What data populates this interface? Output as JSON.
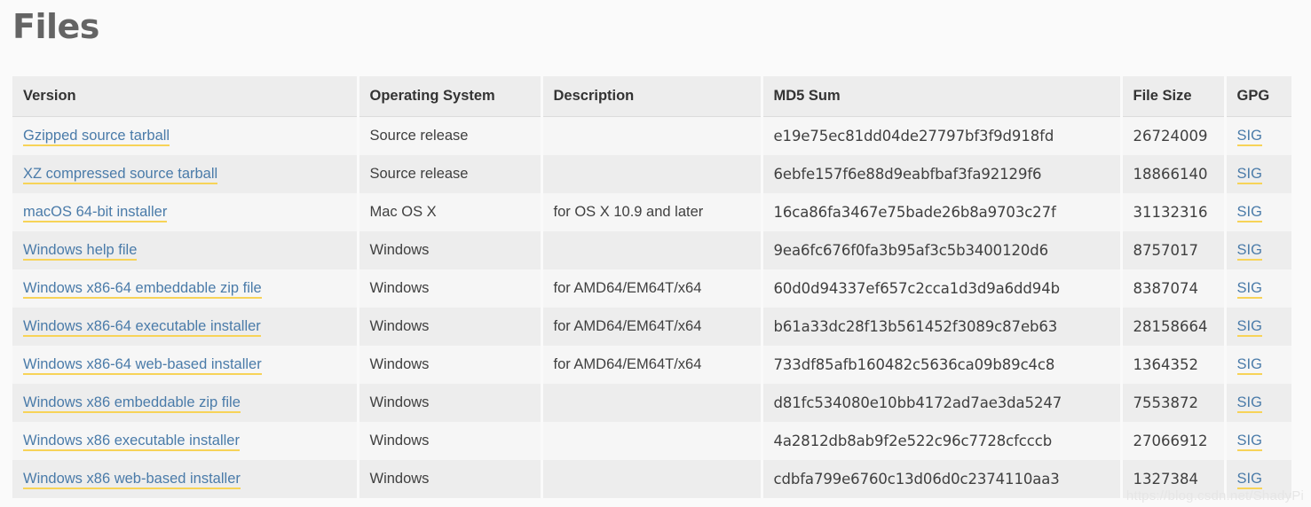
{
  "page": {
    "title": "Files",
    "watermark": "https://blog.csdn.net/ShadyPi",
    "accent_link_color": "#4a7ba9",
    "accent_underline_color": "#f7d358",
    "header_bg": "#ededed",
    "row_odd_bg": "#f6f6f6",
    "row_even_bg": "#ededed",
    "page_bg": "#fafafa",
    "title_color": "#646464"
  },
  "table": {
    "columns": [
      {
        "key": "version",
        "label": "Version"
      },
      {
        "key": "os",
        "label": "Operating System"
      },
      {
        "key": "description",
        "label": "Description"
      },
      {
        "key": "md5",
        "label": "MD5 Sum"
      },
      {
        "key": "filesize",
        "label": "File Size"
      },
      {
        "key": "gpg",
        "label": "GPG"
      }
    ],
    "gpg_link_label": "SIG",
    "rows": [
      {
        "version": "Gzipped source tarball",
        "os": "Source release",
        "description": "",
        "md5": "e19e75ec81dd04de27797bf3f9d918fd",
        "filesize": "26724009",
        "gpg": "SIG"
      },
      {
        "version": "XZ compressed source tarball",
        "os": "Source release",
        "description": "",
        "md5": "6ebfe157f6e88d9eabfbaf3fa92129f6",
        "filesize": "18866140",
        "gpg": "SIG"
      },
      {
        "version": "macOS 64-bit installer",
        "os": "Mac OS X",
        "description": "for OS X 10.9 and later",
        "md5": "16ca86fa3467e75bade26b8a9703c27f",
        "filesize": "31132316",
        "gpg": "SIG"
      },
      {
        "version": "Windows help file",
        "os": "Windows",
        "description": "",
        "md5": "9ea6fc676f0fa3b95af3c5b3400120d6",
        "filesize": "8757017",
        "gpg": "SIG"
      },
      {
        "version": "Windows x86-64 embeddable zip file",
        "os": "Windows",
        "description": "for AMD64/EM64T/x64",
        "md5": "60d0d94337ef657c2cca1d3d9a6dd94b",
        "filesize": "8387074",
        "gpg": "SIG"
      },
      {
        "version": "Windows x86-64 executable installer",
        "os": "Windows",
        "description": "for AMD64/EM64T/x64",
        "md5": "b61a33dc28f13b561452f3089c87eb63",
        "filesize": "28158664",
        "gpg": "SIG"
      },
      {
        "version": "Windows x86-64 web-based installer",
        "os": "Windows",
        "description": "for AMD64/EM64T/x64",
        "md5": "733df85afb160482c5636ca09b89c4c8",
        "filesize": "1364352",
        "gpg": "SIG"
      },
      {
        "version": "Windows x86 embeddable zip file",
        "os": "Windows",
        "description": "",
        "md5": "d81fc534080e10bb4172ad7ae3da5247",
        "filesize": "7553872",
        "gpg": "SIG"
      },
      {
        "version": "Windows x86 executable installer",
        "os": "Windows",
        "description": "",
        "md5": "4a2812db8ab9f2e522c96c7728cfcccb",
        "filesize": "27066912",
        "gpg": "SIG"
      },
      {
        "version": "Windows x86 web-based installer",
        "os": "Windows",
        "description": "",
        "md5": "cdbfa799e6760c13d06d0c2374110aa3",
        "filesize": "1327384",
        "gpg": "SIG"
      }
    ]
  }
}
